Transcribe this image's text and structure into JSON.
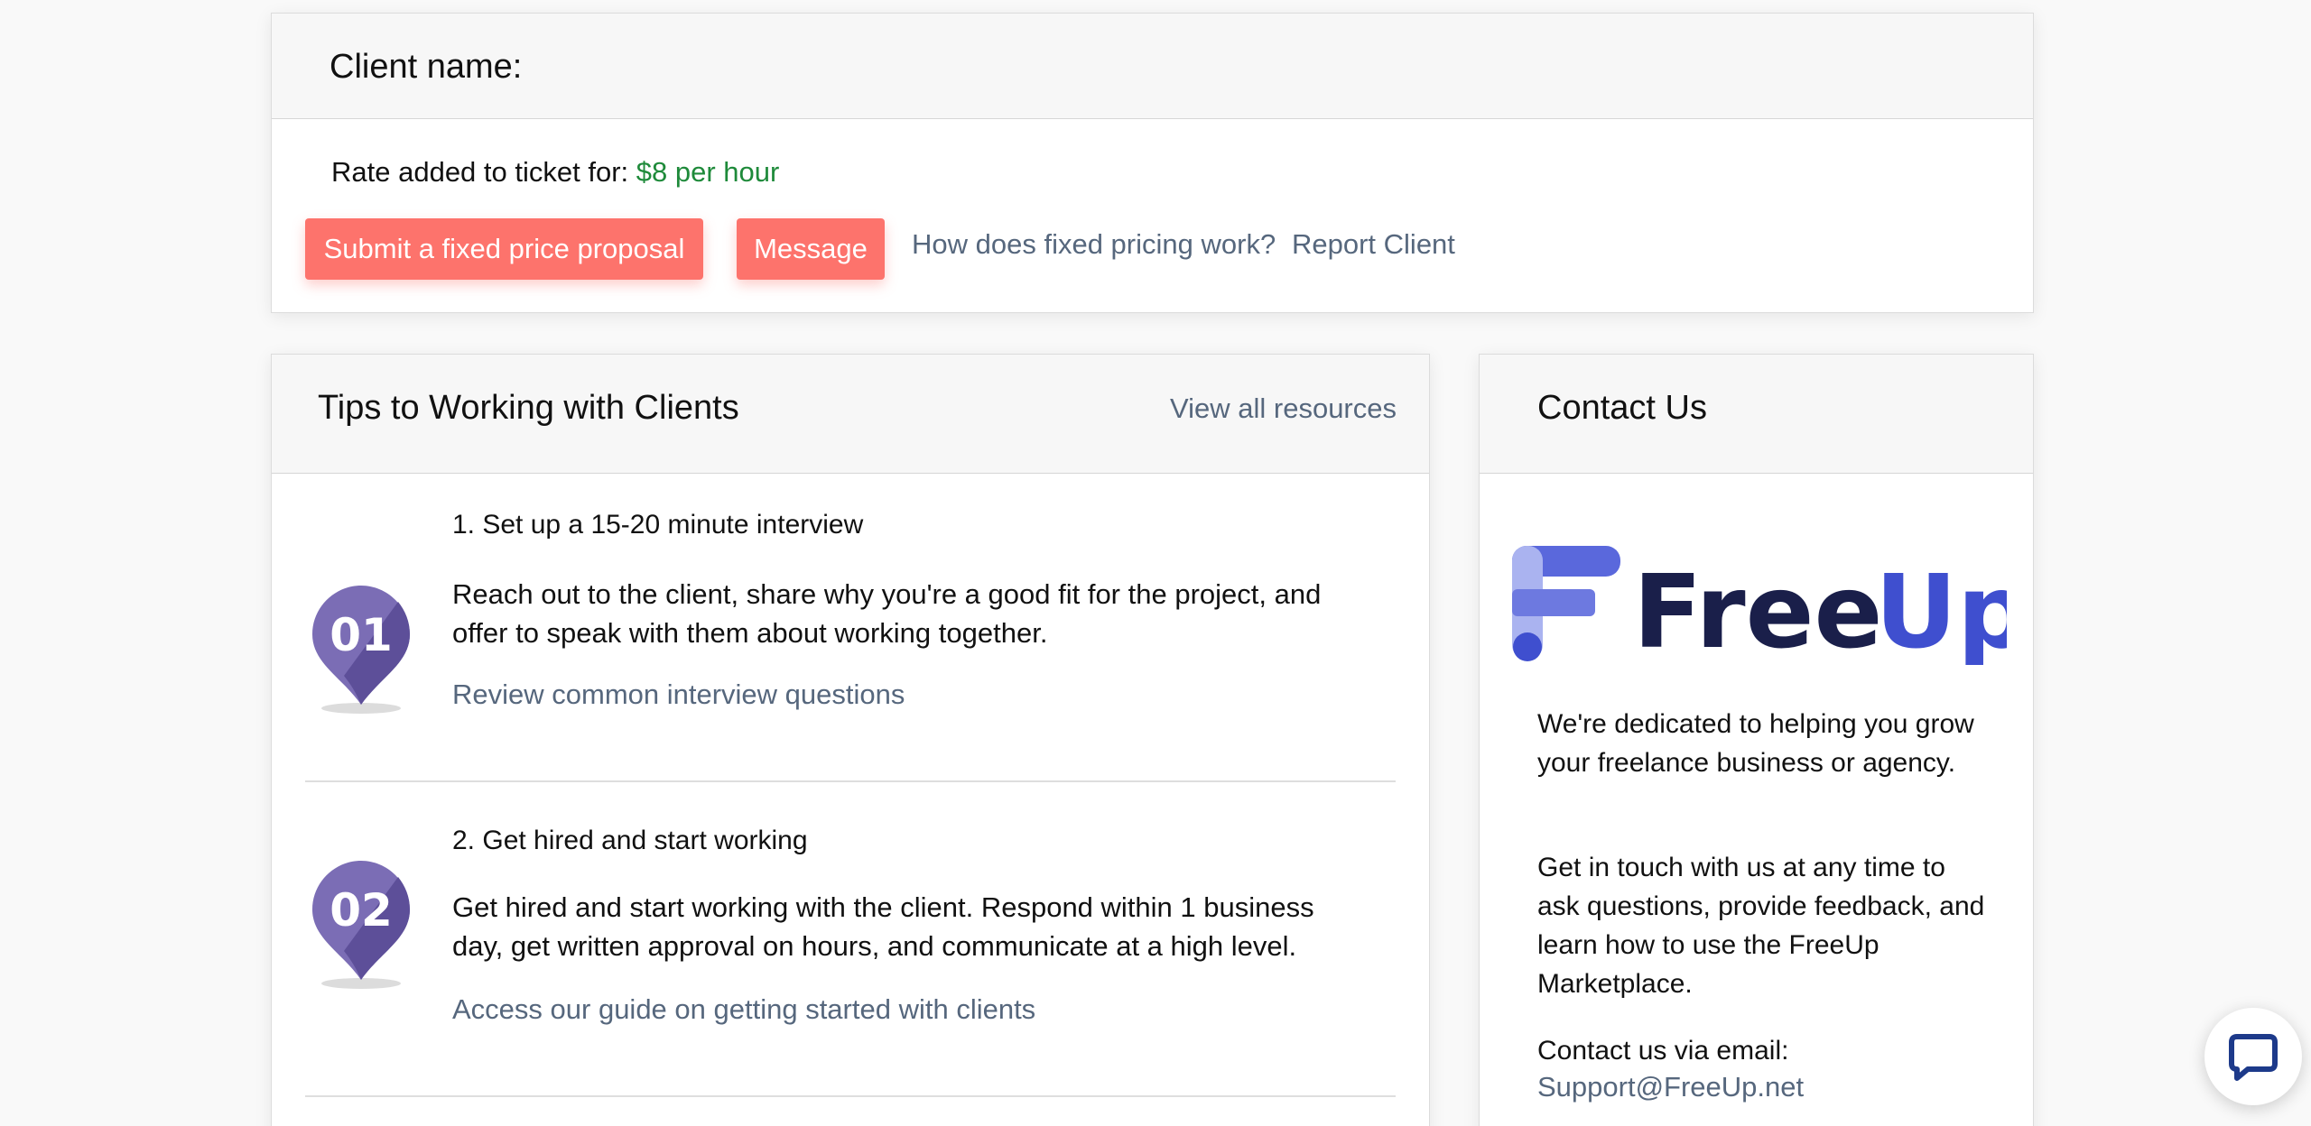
{
  "client": {
    "name_label": "Client name:",
    "rate_prefix": "Rate added to ticket for:",
    "rate_value": "$8 per hour",
    "rate_color": "#1e8a3a"
  },
  "actions": {
    "submit_proposal_label": "Submit a fixed price proposal",
    "message_label": "Message",
    "fixed_pricing_link": "How does fixed pricing work?",
    "report_client_link": "Report Client",
    "button_color": "#fd736c"
  },
  "tips": {
    "title": "Tips to Working with Clients",
    "view_all_link": "View all resources",
    "items": [
      {
        "badge": "01",
        "heading": "1. Set up a 15-20 minute interview",
        "body": "Reach out to the client, share why you're a good fit for the project, and offer to speak with them about working together.",
        "link": "Review common interview questions"
      },
      {
        "badge": "02",
        "heading": "2. Get hired and start working",
        "body": "Get hired and start working with the client. Respond within 1 business day, get written approval on hours, and communicate at a high level.",
        "link": "Access our guide on getting started with clients"
      }
    ]
  },
  "contact": {
    "title": "Contact Us",
    "logo_text_free": "Free",
    "logo_text_up": "Up",
    "paragraph_1": "We're dedicated to helping you grow your freelance business or agency.",
    "paragraph_2": "Get in touch with us at any time to ask questions, provide feedback, and learn how to use the FreeUp Marketplace.",
    "email_prefix": "Contact us via email:",
    "email": "Support@FreeUp.net"
  },
  "icons": {
    "chat": "chat-bubble-icon",
    "pin": "map-pin-icon"
  },
  "colors": {
    "link": "#56677d",
    "pin_purple": "#7b6db5",
    "logo_navy": "#1a1f4a",
    "logo_blue": "#3f4fcf"
  }
}
